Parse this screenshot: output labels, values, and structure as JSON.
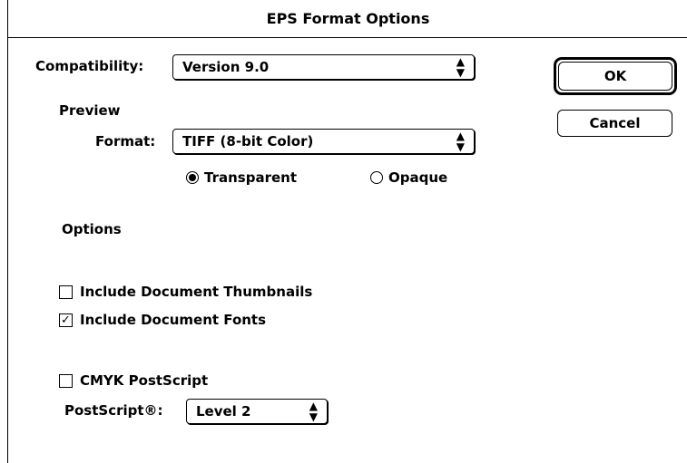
{
  "dialog": {
    "title": "EPS Format Options"
  },
  "compatibility": {
    "label": "Compatibility:",
    "value": "Version 9.0"
  },
  "preview": {
    "heading": "Preview",
    "format_label": "Format:",
    "format_value": "TIFF (8-bit Color)",
    "transparent_label": "Transparent",
    "opaque_label": "Opaque",
    "selected": "Transparent"
  },
  "options": {
    "heading": "Options",
    "include_thumbnails": {
      "label": "Include Document Thumbnails",
      "checked": false
    },
    "include_fonts": {
      "label": "Include Document Fonts",
      "checked": true
    },
    "cmyk_postscript": {
      "label": "CMYK PostScript",
      "checked": false
    },
    "postscript_label": "PostScript®:",
    "postscript_value": "Level 2"
  },
  "buttons": {
    "ok": "OK",
    "cancel": "Cancel"
  },
  "icons": {
    "popup_arrows": "updown-arrows-icon",
    "checkmark": "checkmark-icon"
  }
}
